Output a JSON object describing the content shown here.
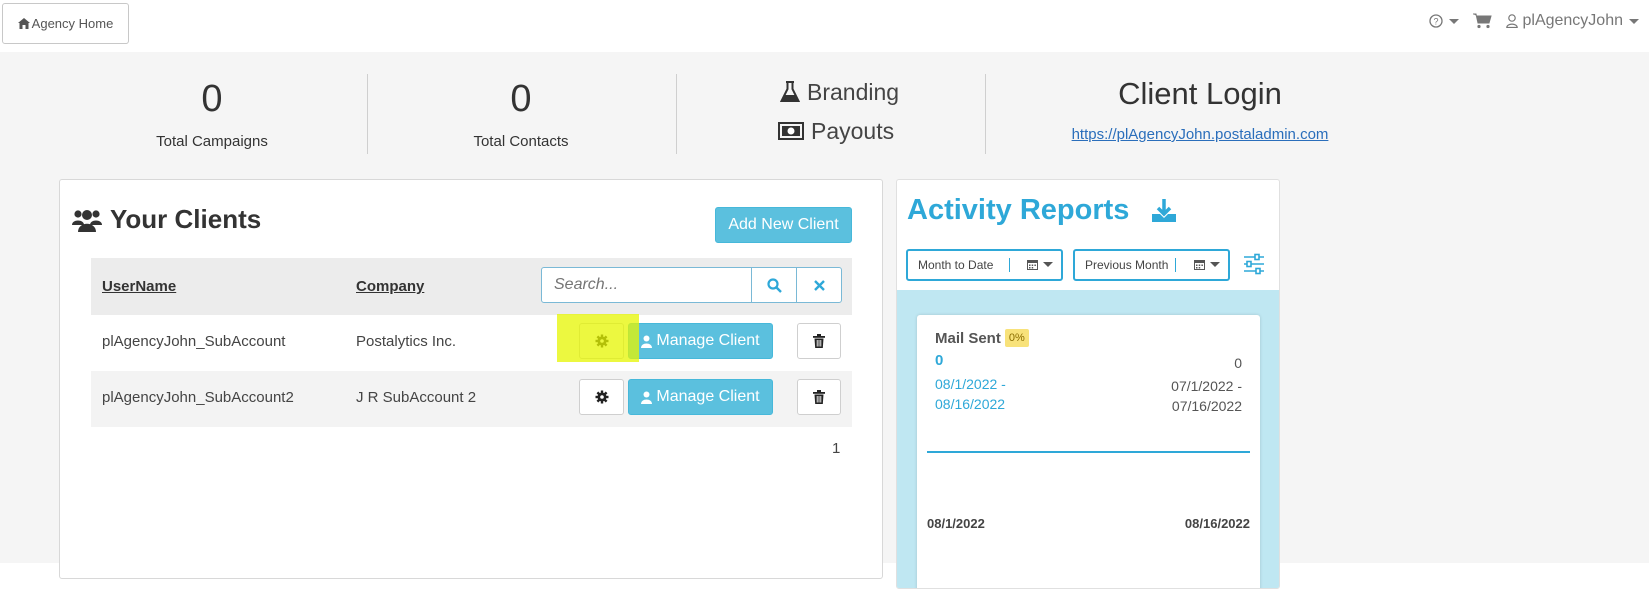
{
  "topbar": {
    "home_label": "Agency Home",
    "username": "plAgencyJohn"
  },
  "stats": {
    "campaigns": {
      "value": "0",
      "label": "Total Campaigns"
    },
    "contacts": {
      "value": "0",
      "label": "Total Contacts"
    },
    "links": [
      {
        "label": "Branding",
        "icon": "flask-icon"
      },
      {
        "label": "Payouts",
        "icon": "money-icon"
      }
    ],
    "client_login": {
      "title": "Client Login",
      "url": "https://plAgencyJohn.postaladmin.com"
    }
  },
  "clients": {
    "title": "Your Clients",
    "add_label": "Add New Client",
    "columns": [
      "UserName",
      "Company"
    ],
    "search_placeholder": "Search...",
    "rows": [
      {
        "username": "plAgencyJohn_SubAccount",
        "company": "Postalytics Inc.",
        "manage_label": "Manage Client"
      },
      {
        "username": "plAgencyJohn_SubAccount2",
        "company": "J R SubAccount 2",
        "manage_label": "Manage Client"
      }
    ],
    "page": "1"
  },
  "activity": {
    "title": "Activity Reports",
    "range_current": "Month to Date",
    "range_previous": "Previous Month",
    "card": {
      "title": "Mail Sent",
      "badge": "0%",
      "current_value": "0",
      "current_start": "08/1/2022 -",
      "current_end": "08/16/2022",
      "previous_value": "0",
      "previous_start": "07/1/2022 -",
      "previous_end": "07/16/2022",
      "axis_start": "08/1/2022",
      "axis_end": "08/16/2022"
    }
  },
  "colors": {
    "accent": "#5bc0de",
    "title_blue": "#2ea8d8",
    "highlight": "#e6f500"
  }
}
